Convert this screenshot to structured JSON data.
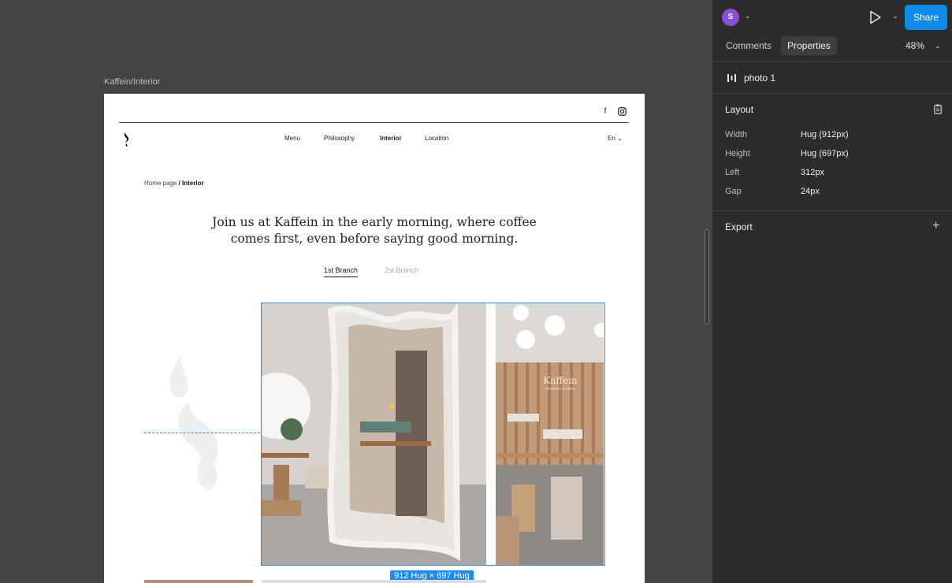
{
  "canvas": {
    "frame_label": "Kaffein/Interior",
    "site": {
      "nav": [
        "Menu",
        "Philosophy",
        "Interior",
        "Location"
      ],
      "active_nav": "Interior",
      "language": "En",
      "breadcrumb_home": "Home page",
      "breadcrumb_sep": " / ",
      "breadcrumb_current": "Interior",
      "hero_line1": "Join us at Kaffein in the early morning, where coffee",
      "hero_line2": "comes first, even before saying good morning.",
      "tab1": "1st Branch",
      "tab2": "2st Branch",
      "sign_name": "Kaffein",
      "sign_sub": "Modern Coffee"
    },
    "selection_badge": "912 Hug × 697 Hug"
  },
  "panel": {
    "avatar_initial": "S",
    "share_label": "Share",
    "tab_comments": "Comments",
    "tab_properties": "Properties",
    "zoom": "48%",
    "layer_name": "photo 1",
    "layout_title": "Layout",
    "props": [
      {
        "label": "Width",
        "value": "Hug (912px)"
      },
      {
        "label": "Height",
        "value": "Hug (697px)"
      },
      {
        "label": "Left",
        "value": "312px"
      },
      {
        "label": "Gap",
        "value": "24px"
      }
    ],
    "export_title": "Export"
  },
  "colors": {
    "canvas_bg": "#444444",
    "panel_bg": "#2c2c2c",
    "accent": "#0d8ce9",
    "selection": "#1a8cff",
    "avatar": "#8a4fd8"
  }
}
